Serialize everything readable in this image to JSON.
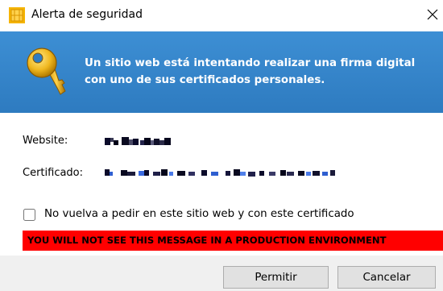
{
  "window": {
    "title": "Alerta de seguridad",
    "close_glyph": "✕"
  },
  "banner": {
    "message": "Un sitio web está intentando realizar una firma digital con uno de sus certificados personales.",
    "icon": "key-icon"
  },
  "details": {
    "website_label": "Website:",
    "certificate_label": "Certificado:"
  },
  "remember": {
    "label": "No vuelva a pedir en este sitio web y con este certificado",
    "checked": false
  },
  "warning": {
    "text": "YOU WILL NOT SEE THIS MESSAGE IN A PRODUCTION ENVIRONMENT",
    "color": "#ff0000"
  },
  "buttons": {
    "allow_label": "Permitir",
    "cancel_label": "Cancelar"
  },
  "colors": {
    "banner": "#3389cf",
    "footer": "#f0f0f0"
  }
}
